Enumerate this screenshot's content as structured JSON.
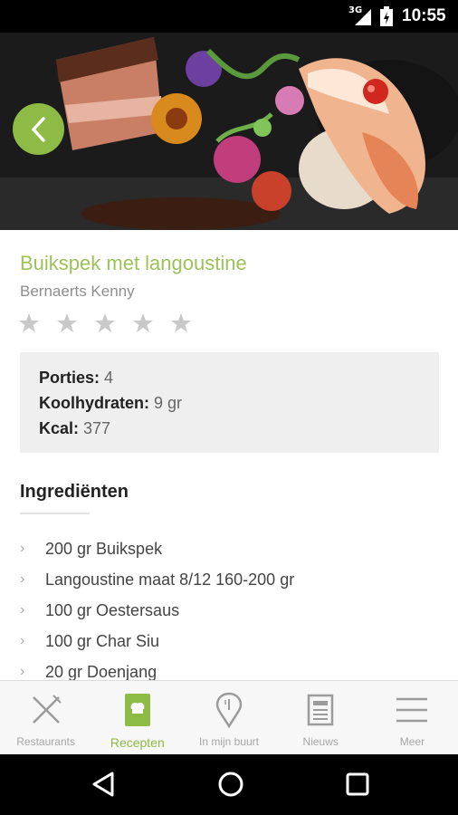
{
  "status_bar": {
    "network": "3G",
    "time": "10:55"
  },
  "recipe": {
    "title": "Buikspek met langoustine",
    "author": "Bernaerts Kenny",
    "rating": 0,
    "max_rating": 5,
    "info": {
      "portions_label": "Porties:",
      "portions": "4",
      "carbs_label": "Koolhydraten:",
      "carbs": "9 gr",
      "kcal_label": "Kcal:",
      "kcal": "377"
    },
    "ingredients_title": "Ingrediënten",
    "ingredients": [
      "200 gr Buikspek",
      "Langoustine maat 8/12 160-200 gr",
      "100 gr Oestersaus",
      "100 gr Char Siu",
      "20 gr Doenjang"
    ]
  },
  "tabs": [
    {
      "label": "Restaurants",
      "icon": "fork-knife-icon"
    },
    {
      "label": "Recepten",
      "icon": "chef-hat-icon",
      "active": true
    },
    {
      "label": "In mijn buurt",
      "icon": "map-pin-icon"
    },
    {
      "label": "Nieuws",
      "icon": "newspaper-icon"
    },
    {
      "label": "Meer",
      "icon": "menu-icon"
    }
  ],
  "colors": {
    "accent": "#8dbb45",
    "title": "#9cc25a"
  }
}
